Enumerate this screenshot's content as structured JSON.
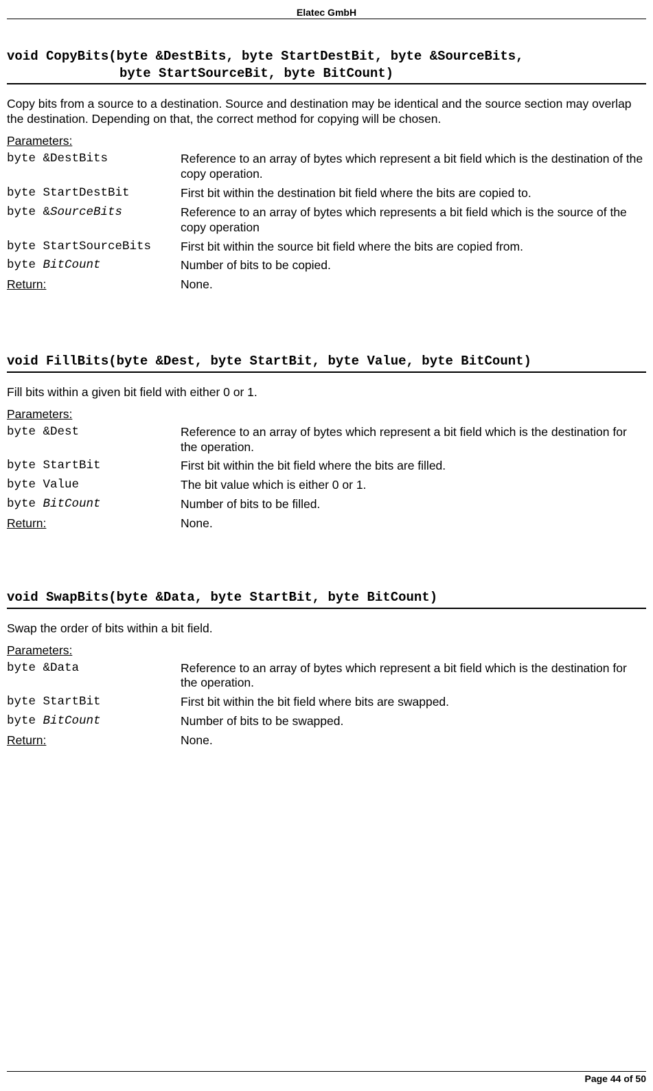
{
  "header": {
    "company": "Elatec GmbH"
  },
  "footer": {
    "page": "Page 44 of 50"
  },
  "func1": {
    "sig_line1": "void CopyBits(byte &DestBits, byte StartDestBit, byte &SourceBits,",
    "sig_line2": "byte StartSourceBit, byte BitCount)",
    "desc": "Copy bits from a source to a destination. Source and destination may be identical and the source section may overlap the destination. Depending on that, the correct method for copying will be chosen.",
    "params_label": "Parameters:",
    "params": [
      {
        "name_pre": "byte &DestBits",
        "name_it": "",
        "desc": "Reference to an array of bytes which represent a bit field which is the destination of the copy operation."
      },
      {
        "name_pre": "byte StartDestBit",
        "name_it": "",
        "desc": "First bit within the destination bit field where the bits are copied to."
      },
      {
        "name_pre": "byte &",
        "name_it": "SourceBits",
        "desc": "Reference to an array of bytes which represents a bit field which is the source of the copy operation"
      },
      {
        "name_pre": "byte StartSourceBits",
        "name_it": "",
        "desc": "First bit within the source bit field where the bits are copied from."
      },
      {
        "name_pre": "byte ",
        "name_it": "BitCount",
        "desc": "Number of bits to be copied."
      }
    ],
    "return_label": "Return:",
    "return_value": "None."
  },
  "func2": {
    "sig": "void FillBits(byte &Dest, byte StartBit, byte Value, byte BitCount)",
    "desc": "Fill bits within a given bit field with either 0 or 1.",
    "params_label": "Parameters:",
    "params": [
      {
        "name_pre": "byte &Dest",
        "name_it": "",
        "desc": "Reference to an array of bytes which represent a bit field which is the destination for the operation."
      },
      {
        "name_pre": "byte StartBit",
        "name_it": "",
        "desc": "First bit within the bit field where the bits are filled."
      },
      {
        "name_pre": "byte Value",
        "name_it": "",
        "desc": "The bit value which is either 0 or 1."
      },
      {
        "name_pre": "byte ",
        "name_it": "BitCount",
        "desc": "Number of bits to be filled."
      }
    ],
    "return_label": "Return:",
    "return_value": "None."
  },
  "func3": {
    "sig": "void SwapBits(byte &Data, byte StartBit, byte BitCount)",
    "desc": "Swap the order of bits within a bit field.",
    "params_label": "Parameters:",
    "params": [
      {
        "name_pre": "byte &Data",
        "name_it": "",
        "desc": "Reference to an array of bytes which represent a bit field which is the destination for the operation."
      },
      {
        "name_pre": "byte StartBit",
        "name_it": "",
        "desc": "First bit within the bit field where bits are swapped."
      },
      {
        "name_pre": "byte ",
        "name_it": "BitCount",
        "desc": "Number of bits to be swapped."
      }
    ],
    "return_label": "Return:",
    "return_value": "None."
  }
}
